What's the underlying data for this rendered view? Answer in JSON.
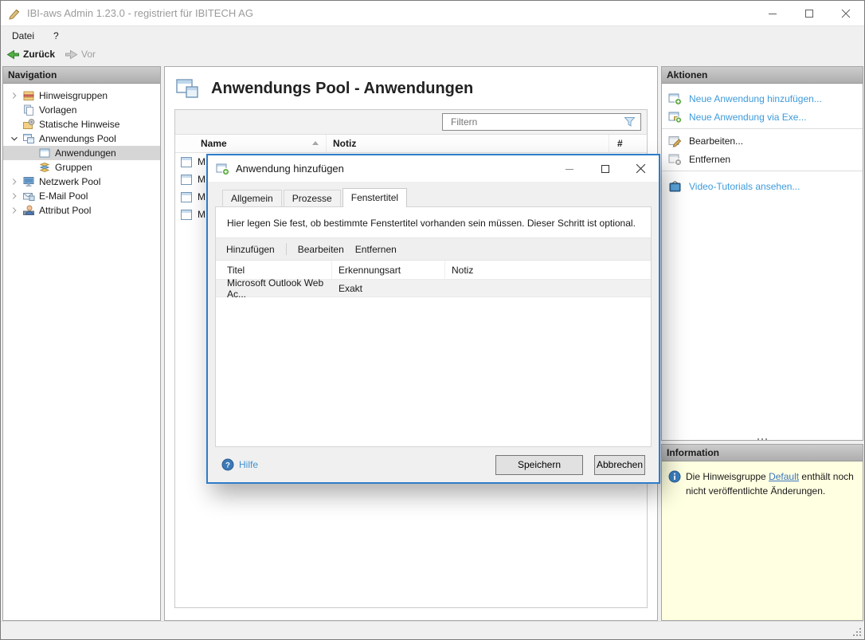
{
  "window": {
    "title": "IBI-aws Admin 1.23.0 - registriert für IBITECH AG"
  },
  "menu": {
    "items": [
      {
        "label": "Datei"
      },
      {
        "label": "?"
      }
    ]
  },
  "toolbar": {
    "back_label": "Zurück",
    "forward_label": "Vor"
  },
  "navigation": {
    "header": "Navigation",
    "items": [
      {
        "label": "Hinweisgruppen",
        "icon": "notice-groups-icon",
        "state": "collapsed",
        "selected": false
      },
      {
        "label": "Vorlagen",
        "icon": "templates-icon",
        "state": "leaf",
        "selected": false
      },
      {
        "label": "Statische Hinweise",
        "icon": "static-notices-icon",
        "state": "leaf",
        "selected": false
      },
      {
        "label": "Anwendungs Pool",
        "icon": "application-pool-icon",
        "state": "expanded",
        "selected": false
      },
      {
        "label": "Anwendungen",
        "icon": "applications-icon",
        "state": "leaf",
        "selected": true
      },
      {
        "label": "Gruppen",
        "icon": "groups-icon",
        "state": "leaf",
        "selected": false
      },
      {
        "label": "Netzwerk Pool",
        "icon": "network-pool-icon",
        "state": "collapsed",
        "selected": false
      },
      {
        "label": "E-Mail Pool",
        "icon": "email-pool-icon",
        "state": "collapsed",
        "selected": false
      },
      {
        "label": "Attribut Pool",
        "icon": "attribute-pool-icon",
        "state": "collapsed",
        "selected": false
      }
    ]
  },
  "main": {
    "title": "Anwendungs Pool - Anwendungen",
    "filter_placeholder": "Filtern",
    "columns": {
      "name": "Name",
      "notiz": "Notiz",
      "count": "#"
    },
    "sort": {
      "column": "Name",
      "direction": "asc"
    },
    "rows": [
      {
        "name_visible": "M"
      },
      {
        "name_visible": "M"
      },
      {
        "name_visible": "M"
      },
      {
        "name_visible": "M"
      }
    ]
  },
  "dialog": {
    "title": "Anwendung hinzufügen",
    "tabs": [
      {
        "label": "Allgemein",
        "active": false
      },
      {
        "label": "Prozesse",
        "active": false
      },
      {
        "label": "Fenstertitel",
        "active": true
      }
    ],
    "description": "Hier legen Sie fest, ob bestimmte Fenstertitel vorhanden sein müssen. Dieser Schritt ist optional.",
    "toolbar": {
      "add": "Hinzufügen",
      "edit": "Bearbeiten",
      "remove": "Entfernen"
    },
    "table": {
      "columns": {
        "titel": "Titel",
        "erkennungsart": "Erkennungsart",
        "notiz": "Notiz"
      },
      "rows": [
        {
          "titel": "Microsoft Outlook Web Ac...",
          "erkennungsart": "Exakt",
          "notiz": ""
        }
      ]
    },
    "help_label": "Hilfe",
    "save_label": "Speichern",
    "cancel_label": "Abbrechen"
  },
  "actions": {
    "header": "Aktionen",
    "items": [
      {
        "label": "Neue Anwendung hinzufügen...",
        "kind": "link",
        "icon": "window-add-icon"
      },
      {
        "label": "Neue Anwendung via Exe...",
        "kind": "link",
        "icon": "window-add-exe-icon"
      },
      {
        "label": "Bearbeiten...",
        "kind": "default",
        "icon": "window-edit-icon"
      },
      {
        "label": "Entfernen",
        "kind": "default",
        "icon": "window-remove-icon"
      },
      {
        "label": "Video-Tutorials ansehen...",
        "kind": "link",
        "icon": "video-tutorials-icon"
      }
    ]
  },
  "information": {
    "header": "Information",
    "text_before": "Die Hinweisgruppe ",
    "link_label": "Default",
    "text_after": " enthält noch nicht veröffentlichte Änderungen."
  },
  "colors": {
    "link_blue": "#3e9bdb",
    "dialog_border_blue": "#2e7cc9",
    "info_background": "#ffffe1",
    "selection_gray": "#d6d6d6",
    "panel_header_top": "#cccccc",
    "panel_header_bottom": "#aeaeae"
  }
}
